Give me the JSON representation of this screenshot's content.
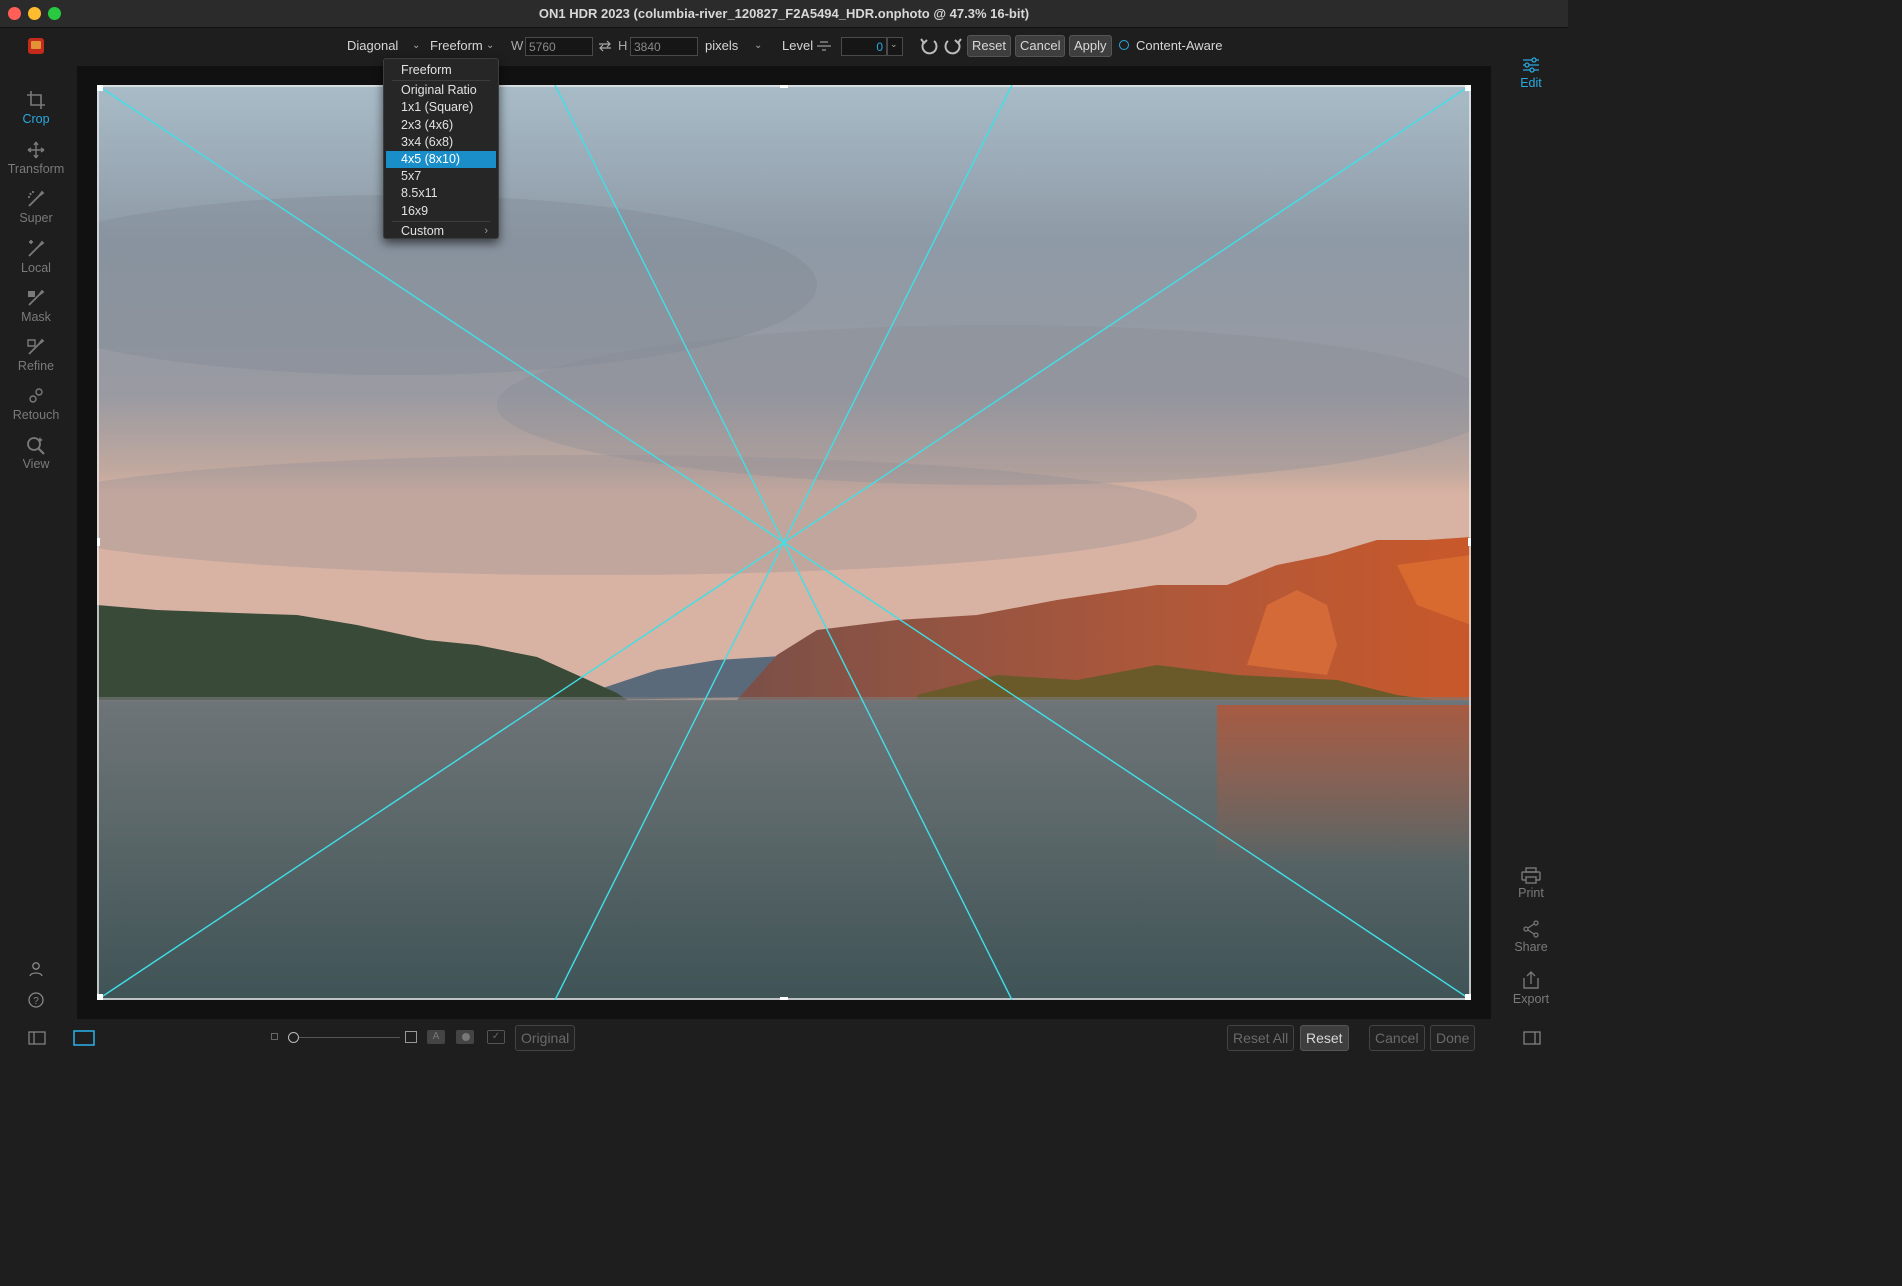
{
  "window": {
    "title": "ON1 HDR 2023 (columbia-river_120827_F2A5494_HDR.onphoto @ 47.3% 16-bit)"
  },
  "toolbar": {
    "overlay_mode": "Diagonal",
    "aspect_preset": "Freeform",
    "width_label": "W",
    "width_value": "5760",
    "height_label": "H",
    "height_value": "3840",
    "units": "pixels",
    "level_label": "Level",
    "level_value": "0",
    "reset_label": "Reset",
    "cancel_label": "Cancel",
    "apply_label": "Apply",
    "content_aware_label": "Content-Aware"
  },
  "aspect_menu": {
    "items": [
      {
        "label": "Freeform"
      },
      {
        "label": "Original Ratio"
      },
      {
        "label": "1x1 (Square)"
      },
      {
        "label": "2x3 (4x6)"
      },
      {
        "label": "3x4 (6x8)"
      },
      {
        "label": "4x5 (8x10)",
        "selected": true
      },
      {
        "label": "5x7"
      },
      {
        "label": "8.5x11"
      },
      {
        "label": "16x9"
      },
      {
        "label": "Custom"
      }
    ]
  },
  "left_tools": [
    {
      "label": "Crop",
      "icon": "crop-icon",
      "active": true
    },
    {
      "label": "Transform",
      "icon": "transform-icon"
    },
    {
      "label": "Super",
      "icon": "super-brush-icon"
    },
    {
      "label": "Local",
      "icon": "local-brush-icon"
    },
    {
      "label": "Mask",
      "icon": "mask-brush-icon"
    },
    {
      "label": "Refine",
      "icon": "refine-brush-icon"
    },
    {
      "label": "Retouch",
      "icon": "retouch-icon"
    },
    {
      "label": "View",
      "icon": "view-icon"
    }
  ],
  "right_panel": {
    "edit_label": "Edit",
    "print_label": "Print",
    "share_label": "Share",
    "export_label": "Export"
  },
  "bottom_bar": {
    "original_label": "Original",
    "reset_all_label": "Reset All",
    "reset_label": "Reset",
    "cancel_label": "Cancel",
    "done_label": "Done"
  },
  "colors": {
    "accent": "#2aa9e0",
    "guide_lines": "#3fe0e8",
    "selection": "#1a8ec9"
  }
}
